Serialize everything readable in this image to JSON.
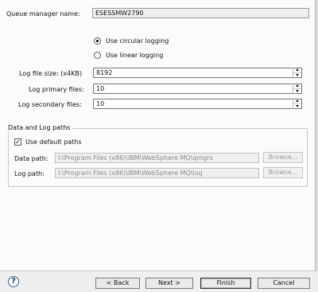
{
  "queue_manager": {
    "label": "Queue manager name:",
    "value": "ESESSMW2790"
  },
  "logging": {
    "circular_label": "Use circular logging",
    "linear_label": "Use linear logging",
    "selected": "circular"
  },
  "log_file_size": {
    "label": "Log file size: (x4KB)",
    "value": "8192"
  },
  "log_primary_files": {
    "label": "Log primary files:",
    "value": "10"
  },
  "log_secondary_files": {
    "label": "Log secondary files:",
    "value": "10"
  },
  "paths": {
    "group_label": "Data and Log paths",
    "use_default_label": "Use default paths",
    "use_default_checked": true,
    "data_path_label": "Data path:",
    "data_path_value": "I:\\Program Files (x86)\\IBM\\WebSphere MQ\\qmgrs",
    "log_path_label": "Log path:",
    "log_path_value": "I:\\Program Files (x86)\\IBM\\WebSphere MQ\\log",
    "browse_label": "Browse..."
  },
  "footer": {
    "help_glyph": "?",
    "back_label": "< Back",
    "next_label": "Next >",
    "finish_label": "Finish",
    "cancel_label": "Cancel"
  },
  "colors": {
    "background": "#fbfbfb",
    "footer": "#efefef",
    "disabled_text": "#8a8a8a"
  }
}
